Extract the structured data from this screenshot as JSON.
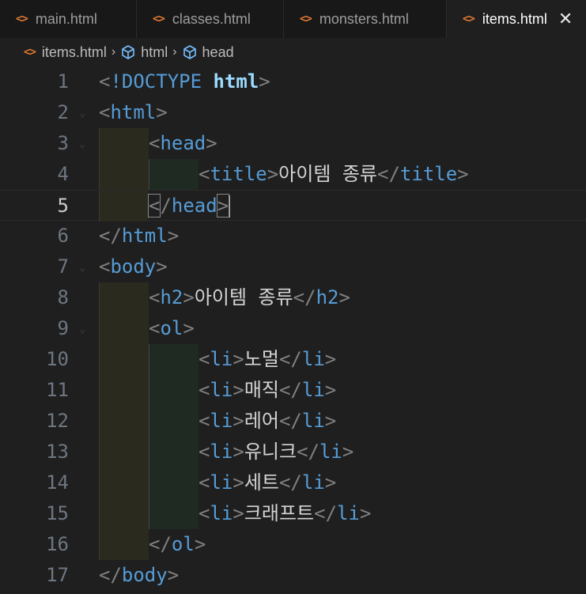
{
  "tabs": [
    {
      "label": "main.html",
      "active": false
    },
    {
      "label": "classes.html",
      "active": false
    },
    {
      "label": "monsters.html",
      "active": false
    },
    {
      "label": "items.html",
      "active": true
    }
  ],
  "tab_close": "✕",
  "file_icon_glyph": "<>",
  "breadcrumb": {
    "file": "items.html",
    "items": [
      "html",
      "head"
    ]
  },
  "lines": {
    "n1": "1",
    "n2": "2",
    "n3": "3",
    "n4": "4",
    "n5": "5",
    "n6": "6",
    "n7": "7",
    "n8": "8",
    "n9": "9",
    "n10": "10",
    "n11": "11",
    "n12": "12",
    "n13": "13",
    "n14": "14",
    "n15": "15",
    "n16": "16",
    "n17": "17"
  },
  "code": {
    "doctype": "!DOCTYPE",
    "doctype_arg": "html",
    "html": "html",
    "head": "head",
    "title": "title",
    "title_text": "아이템 종류",
    "body": "body",
    "h2": "h2",
    "h2_text": "아이템 종류",
    "ol": "ol",
    "li": "li",
    "items": [
      "노멀",
      "매직",
      "레어",
      "유니크",
      "세트",
      "크래프트"
    ]
  },
  "active_line": 5,
  "colors": {
    "tag": "#569cd6",
    "bracket": "#808080",
    "text": "#d4d4d4",
    "file_icon": "#e37933"
  }
}
